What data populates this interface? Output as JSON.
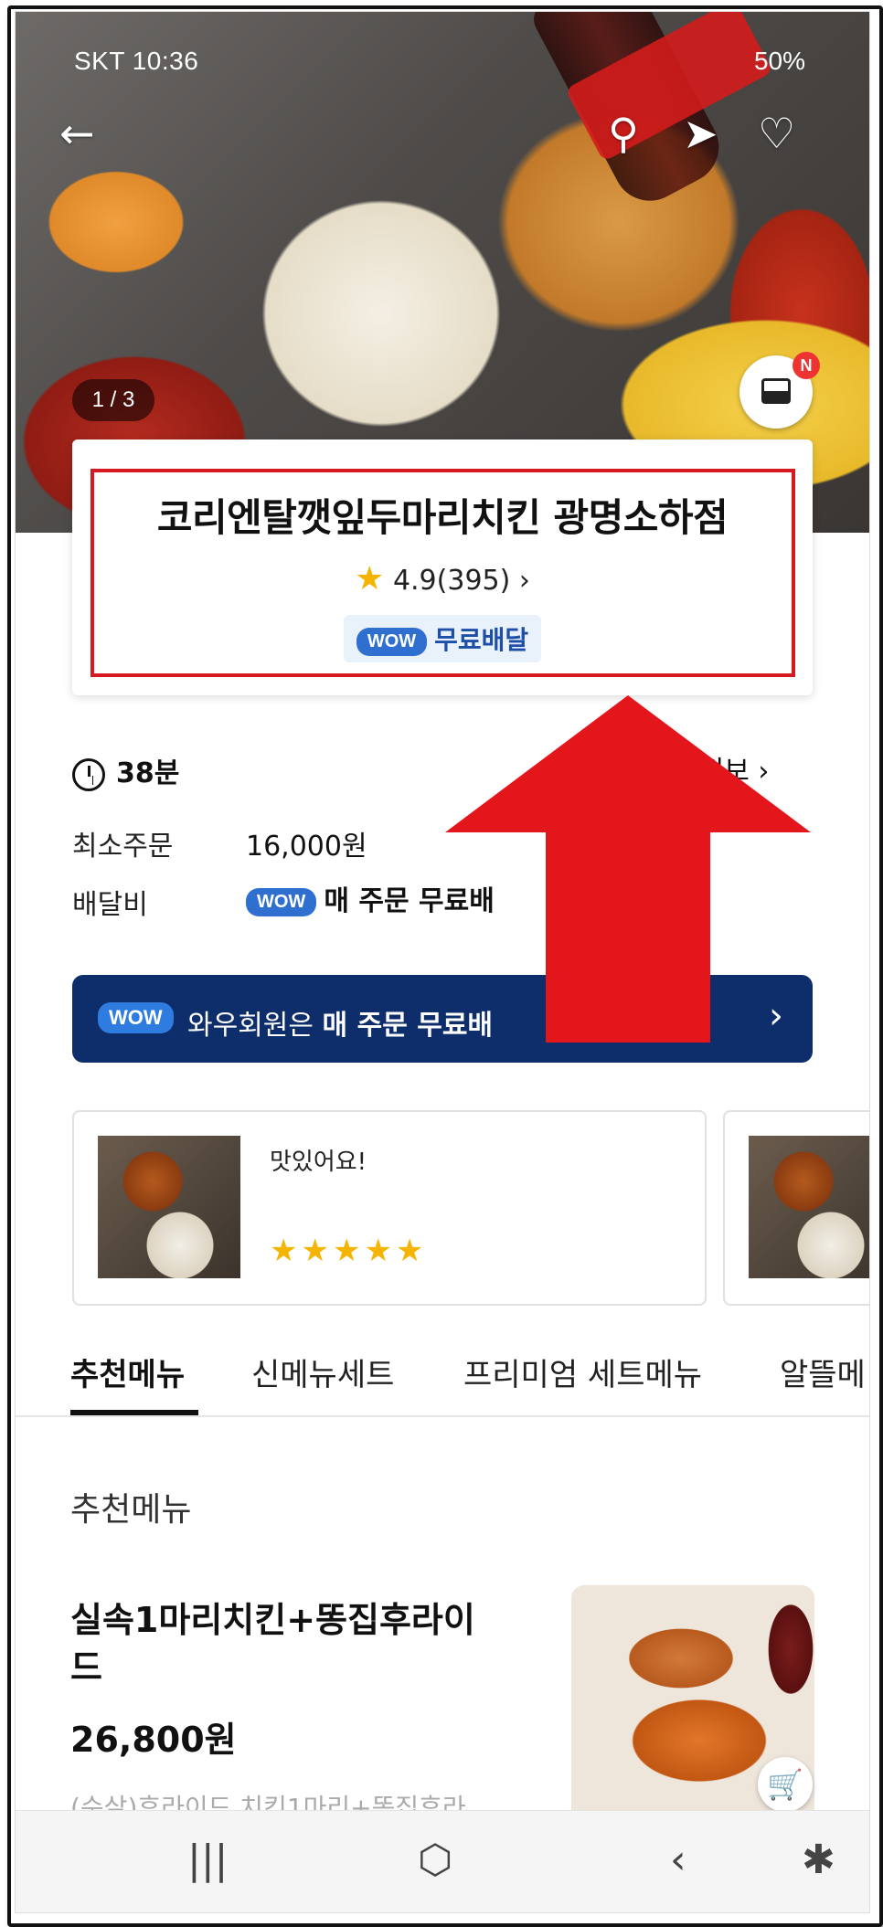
{
  "status_bar": {
    "left": "SKT 10:36",
    "right": "50%"
  },
  "hero": {
    "counter": "1 / 3",
    "new_badge": "N"
  },
  "store": {
    "name": "코리엔탈깻잎두마리치킨 광명소하점",
    "rating": "4.9(395)",
    "wow": "WOW",
    "free_delivery": "무료배달"
  },
  "info": {
    "time": "38분",
    "notice": "지정보",
    "min_order_label": "최소주문",
    "min_order_value": "16,000원",
    "delivery_fee_label": "배달비",
    "delivery_fee_value": "매 주문 무료배"
  },
  "banner": {
    "wow": "WOW",
    "text_normal": "와우회원은 ",
    "text_bold": "매 주문 무료배"
  },
  "reviews": [
    {
      "text": "맛있어요!",
      "stars": "★★★★★"
    }
  ],
  "tabs": [
    "추천메뉴",
    "신메뉴세트",
    "프리미엄 세트메뉴",
    "알뜰메"
  ],
  "section": {
    "title": "추천메뉴",
    "item_name": "실속1마리치킨+똥집후라이드",
    "item_price": "26,800원",
    "item_desc": "(순살)후라이드 치킨1마리+똥집후라"
  },
  "colors": {
    "wow_blue": "#2f6fd0",
    "banner_navy": "#0d2d6b",
    "highlight_red": "#d71a21",
    "star_yellow": "#f5b400"
  },
  "icons": [
    "back-arrow-icon",
    "search-icon",
    "share-icon",
    "heart-icon",
    "photo-icon",
    "clock-icon",
    "chevron-right-icon",
    "cart-add-icon",
    "recent-apps-icon",
    "home-icon",
    "back-icon",
    "accessibility-icon"
  ]
}
